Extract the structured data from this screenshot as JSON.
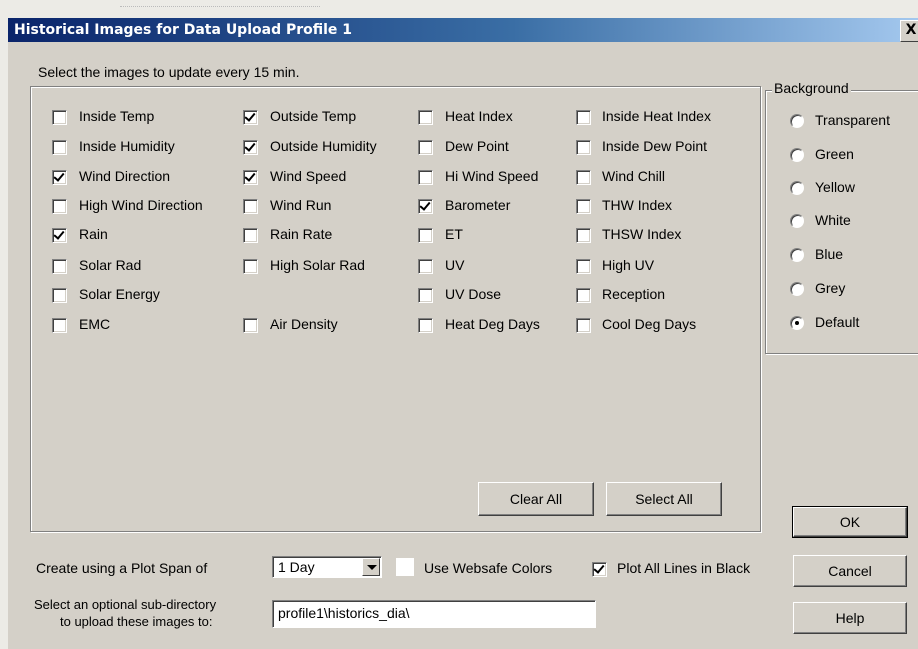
{
  "window": {
    "title": "Historical Images for Data Upload Profile 1",
    "close_glyph": "X"
  },
  "prompt": "Select the images to update every 15 min.",
  "checkboxes": [
    {
      "label": "Inside Temp",
      "checked": false
    },
    {
      "label": "Inside Humidity",
      "checked": false
    },
    {
      "label": "Wind Direction",
      "checked": true
    },
    {
      "label": "High Wind Direction",
      "checked": false
    },
    {
      "label": "Rain",
      "checked": true
    },
    {
      "label": "Solar Rad",
      "checked": false
    },
    {
      "label": "Solar Energy",
      "checked": false
    },
    {
      "label": "EMC",
      "checked": false
    },
    {
      "label": "Outside Temp",
      "checked": true
    },
    {
      "label": "Outside Humidity",
      "checked": true
    },
    {
      "label": "Wind Speed",
      "checked": true
    },
    {
      "label": "Wind Run",
      "checked": false
    },
    {
      "label": "Rain Rate",
      "checked": false
    },
    {
      "label": "High Solar Rad",
      "checked": false
    },
    {
      "label": "Air Density",
      "checked": false
    },
    {
      "label": "Heat Index",
      "checked": false
    },
    {
      "label": "Dew Point",
      "checked": false
    },
    {
      "label": "Hi Wind Speed",
      "checked": false
    },
    {
      "label": "Barometer",
      "checked": true
    },
    {
      "label": "ET",
      "checked": false
    },
    {
      "label": "UV",
      "checked": false
    },
    {
      "label": "UV Dose",
      "checked": false
    },
    {
      "label": "Heat Deg Days",
      "checked": false
    },
    {
      "label": "Inside Heat Index",
      "checked": false
    },
    {
      "label": "Inside Dew Point",
      "checked": false
    },
    {
      "label": "Wind Chill",
      "checked": false
    },
    {
      "label": "THW Index",
      "checked": false
    },
    {
      "label": "THSW Index",
      "checked": false
    },
    {
      "label": "High UV",
      "checked": false
    },
    {
      "label": "Reception",
      "checked": false
    },
    {
      "label": "Cool Deg Days",
      "checked": false
    }
  ],
  "buttons": {
    "clear_all": "Clear All",
    "select_all": "Select All",
    "ok": "OK",
    "cancel": "Cancel",
    "help": "Help"
  },
  "background": {
    "label": "Background",
    "options": [
      "Transparent",
      "Green",
      "Yellow",
      "White",
      "Blue",
      "Grey",
      "Default"
    ],
    "selected": "Default"
  },
  "plot_span": {
    "label": "Create using a Plot Span of",
    "value": "1 Day"
  },
  "websafe": {
    "label": "Use Websafe Colors",
    "checked": false
  },
  "black_lines": {
    "label": "Plot All Lines in Black",
    "checked": true
  },
  "subdir": {
    "label_line1": "Select an optional sub-directory",
    "label_line2": "to upload these images to:",
    "value": "profile1\\historics_dia\\"
  }
}
